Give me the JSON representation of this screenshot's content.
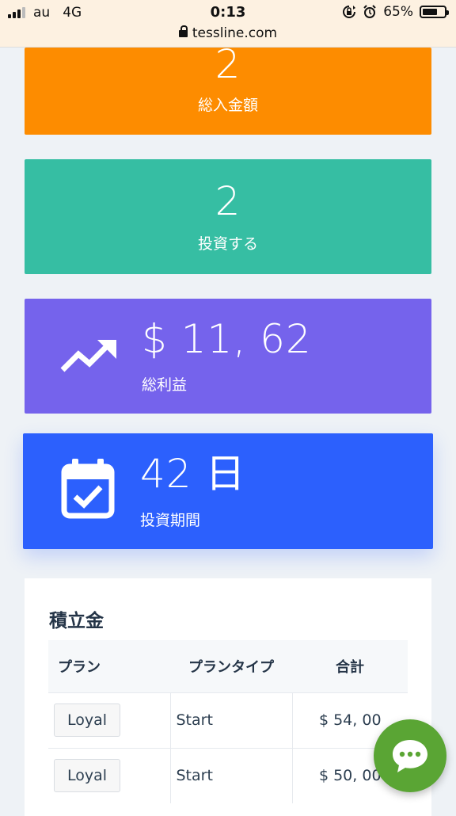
{
  "status_bar": {
    "carrier": "au",
    "network": "4G",
    "time": "0:13",
    "battery": "65%",
    "url": "tessline.com"
  },
  "cards": [
    {
      "id": "total-deposit",
      "value": "2",
      "label": "総入金額",
      "color": "#fd8c00"
    },
    {
      "id": "investments",
      "value": "2",
      "label": "投資する",
      "color": "#36bea3"
    },
    {
      "id": "total-profit",
      "value": "$ 11, 62",
      "label": "総利益",
      "color": "#7563ec",
      "icon": "trending-up-icon"
    },
    {
      "id": "investment-period",
      "value": "42 日",
      "label": "投資期間",
      "color": "#2c60fd",
      "icon": "calendar-check-icon"
    }
  ],
  "savings": {
    "title": "積立金",
    "columns": [
      "プラン",
      "プランタイプ",
      "合計"
    ],
    "rows": [
      {
        "plan": "Loyal",
        "type": "Start",
        "total": "$ 54, 00"
      },
      {
        "plan": "Loyal",
        "type": "Start",
        "total": "$ 50, 00"
      }
    ]
  },
  "chat_button": {
    "icon": "chat-bubble-icon",
    "color": "#5aa534"
  }
}
